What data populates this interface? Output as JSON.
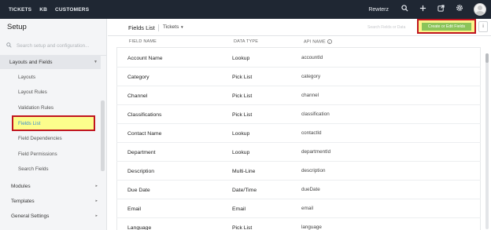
{
  "topnav": {
    "items": [
      "TICKETS",
      "KB",
      "CUSTOMERS"
    ],
    "org_name": "Rewterz",
    "icons": [
      "search-icon",
      "plus-icon",
      "external-link-icon",
      "gear-icon",
      "avatar"
    ]
  },
  "sidebar": {
    "title": "Setup",
    "search_placeholder": "Search setup and configuration...",
    "section_open": "Layouts and Fields",
    "items": [
      "Layouts",
      "Layout Rules",
      "Validation Rules",
      "Fields List",
      "Field Dependencies",
      "Field Permissions",
      "Search Fields"
    ],
    "active_item": "Fields List",
    "sections": [
      "Modules",
      "Templates",
      "General Settings"
    ]
  },
  "header": {
    "title": "Fields List",
    "module": "Tickets",
    "search_placeholder": "Search Fields or Data",
    "create_button": "Create or Edit Fields",
    "info_button": "i"
  },
  "table": {
    "columns": [
      "FIELD NAME",
      "DATA TYPE",
      "API NAME"
    ],
    "rows": [
      {
        "name": "Account Name",
        "type": "Lookup",
        "api": "accountId"
      },
      {
        "name": "Category",
        "type": "Pick List",
        "api": "category"
      },
      {
        "name": "Channel",
        "type": "Pick List",
        "api": "channel"
      },
      {
        "name": "Classifications",
        "type": "Pick List",
        "api": "classification"
      },
      {
        "name": "Contact Name",
        "type": "Lookup",
        "api": "contactId"
      },
      {
        "name": "Department",
        "type": "Lookup",
        "api": "departmentId"
      },
      {
        "name": "Description",
        "type": "Multi-Line",
        "api": "description"
      },
      {
        "name": "Due Date",
        "type": "Date/Time",
        "api": "dueDate"
      },
      {
        "name": "Email",
        "type": "Email",
        "api": "email"
      },
      {
        "name": "Language",
        "type": "Pick List",
        "api": "language"
      }
    ]
  },
  "colors": {
    "topbar": "#1f2733",
    "create_button": "#8bc45a",
    "highlight_border": "#c0141e",
    "highlight_fill": "#fcfd8c",
    "active_link": "#3a8fd0"
  }
}
